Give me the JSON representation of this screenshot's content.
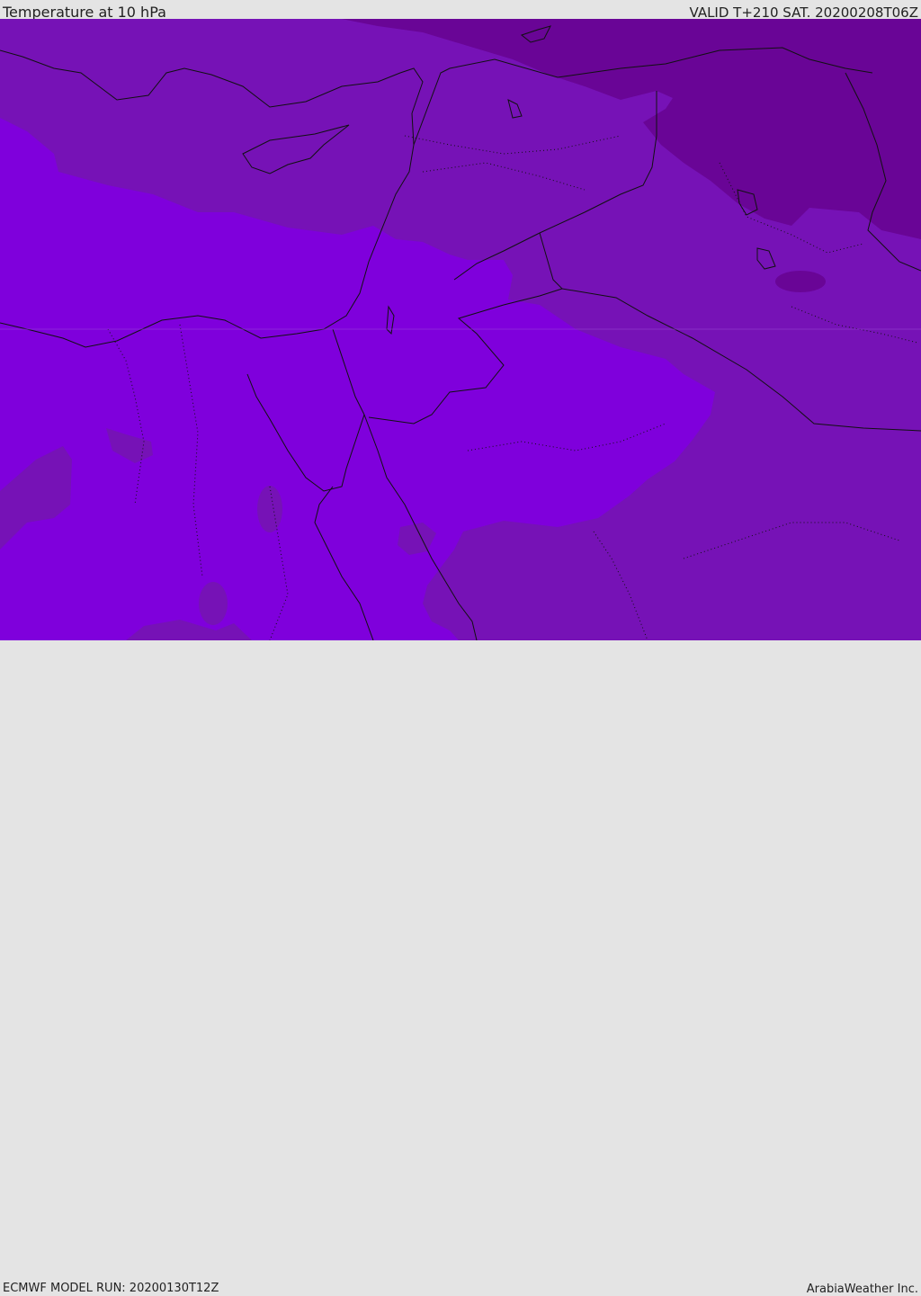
{
  "header": {
    "title": "Temperature at 10 hPa",
    "valid_time": "VALID T+210 SAT. 20200208T06Z"
  },
  "footer": {
    "model_run": "ECMWF MODEL RUN: 20200130T12Z",
    "brand": "ArabiaWeather Inc."
  },
  "map": {
    "field": "temperature",
    "pressure_level": "10 hPa",
    "colors": {
      "warm_violet": "#7f00dc",
      "mid_purple": "#7612b6",
      "dark_purple": "#690596",
      "coastline": "#111111"
    }
  }
}
